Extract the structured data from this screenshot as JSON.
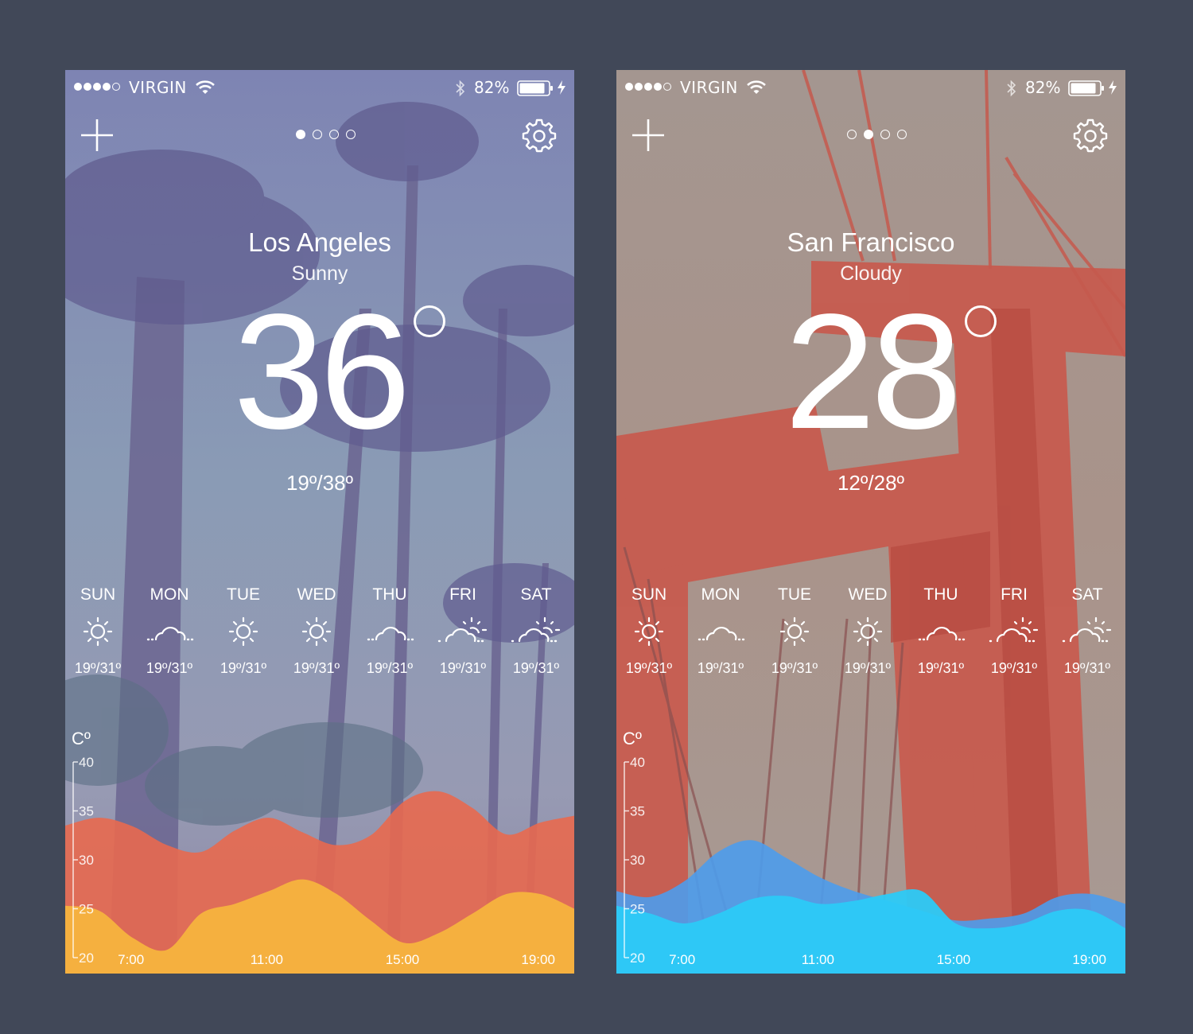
{
  "status_bar": {
    "carrier": "VIRGIN",
    "battery_percent": "82%",
    "signal_bars": 4,
    "signal_total": 5
  },
  "screens": [
    {
      "city": "Los Angeles",
      "condition": "Sunny",
      "temperature": "36",
      "range": "19º/38º",
      "page_index": 0,
      "page_count": 4,
      "forecast": [
        {
          "day": "SUN",
          "icon": "sun-icon",
          "range": "19º/31º"
        },
        {
          "day": "MON",
          "icon": "cloud-icon",
          "range": "19º/31º"
        },
        {
          "day": "TUE",
          "icon": "sun-icon",
          "range": "19º/31º"
        },
        {
          "day": "WED",
          "icon": "sun-icon",
          "range": "19º/31º"
        },
        {
          "day": "THU",
          "icon": "cloud-icon",
          "range": "19º/31º"
        },
        {
          "day": "FRI",
          "icon": "partly-cloudy-icon",
          "range": "19º/31º"
        },
        {
          "day": "SAT",
          "icon": "partly-cloudy-icon",
          "range": "19º/31º"
        }
      ],
      "colors": {
        "back_wave": "#e8694f",
        "front_wave": "#f5b43e"
      }
    },
    {
      "city": "San Francisco",
      "condition": "Cloudy",
      "temperature": "28",
      "range": "12º/28º",
      "page_index": 1,
      "page_count": 4,
      "forecast": [
        {
          "day": "SUN",
          "icon": "sun-icon",
          "range": "19º/31º"
        },
        {
          "day": "MON",
          "icon": "cloud-icon",
          "range": "19º/31º"
        },
        {
          "day": "TUE",
          "icon": "sun-icon",
          "range": "19º/31º"
        },
        {
          "day": "WED",
          "icon": "sun-icon",
          "range": "19º/31º"
        },
        {
          "day": "THU",
          "icon": "cloud-icon",
          "range": "19º/31º"
        },
        {
          "day": "FRI",
          "icon": "partly-cloudy-icon",
          "range": "19º/31º"
        },
        {
          "day": "SAT",
          "icon": "partly-cloudy-icon",
          "range": "19º/31º"
        }
      ],
      "colors": {
        "back_wave": "#4d9cec",
        "front_wave": "#2ccaf7"
      }
    }
  ],
  "chart_data": [
    {
      "type": "area",
      "unit": "Cº",
      "yticks": [
        40,
        35,
        30,
        25,
        20
      ],
      "ylim": [
        20,
        40
      ],
      "xtick_labels": [
        "7:00",
        "11:00",
        "15:00",
        "19:00"
      ],
      "x": [
        6,
        7,
        8,
        9,
        10,
        11,
        12,
        13,
        14,
        15,
        16,
        17,
        18,
        19,
        20,
        21
      ],
      "series": [
        {
          "values": [
            33.5,
            34.3,
            33.4,
            31.5,
            30.8,
            33.0,
            34.3,
            32.8,
            31.5,
            32.5,
            36.0,
            37.0,
            35.3,
            32.6,
            33.8,
            34.5
          ]
        },
        {
          "values": [
            25.3,
            24.8,
            22.0,
            20.8,
            24.5,
            25.5,
            26.8,
            28.0,
            26.5,
            23.8,
            21.5,
            22.5,
            24.5,
            26.5,
            26.5,
            25.0
          ]
        }
      ]
    },
    {
      "type": "area",
      "unit": "Cº",
      "yticks": [
        40,
        35,
        30,
        25,
        20
      ],
      "ylim": [
        20,
        40
      ],
      "xtick_labels": [
        "7:00",
        "11:00",
        "15:00",
        "19:00"
      ],
      "x": [
        6,
        7,
        8,
        9,
        10,
        11,
        12,
        13,
        14,
        15,
        16,
        17,
        18,
        19,
        20,
        21
      ],
      "series": [
        {
          "values": [
            26.8,
            26.2,
            27.8,
            30.8,
            32.0,
            30.2,
            28.2,
            26.8,
            25.8,
            24.8,
            23.8,
            24.0,
            24.5,
            26.2,
            26.5,
            25.5
          ]
        },
        {
          "values": [
            25.3,
            24.5,
            23.5,
            24.5,
            26.0,
            26.3,
            25.5,
            25.8,
            26.5,
            26.8,
            23.5,
            23.0,
            23.5,
            24.8,
            24.8,
            23.0
          ]
        }
      ]
    }
  ]
}
